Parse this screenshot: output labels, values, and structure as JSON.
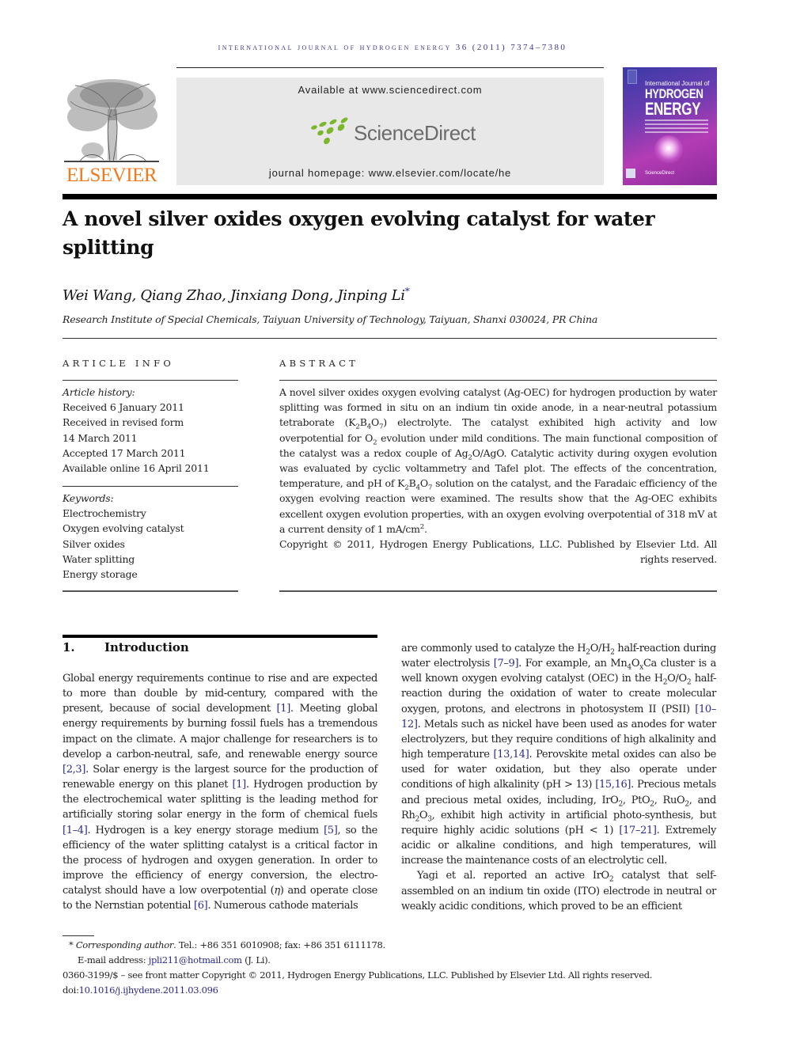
{
  "running_head": "INTERNATIONAL JOURNAL OF HYDROGEN ENERGY 36 (2011) 7374–7380",
  "header": {
    "publisher_logo": "ELSEVIER",
    "available_at": "Available at www.sciencedirect.com",
    "sciencedirect_logo": "ScienceDirect",
    "journal_homepage": "journal homepage: www.elsevier.com/locate/he",
    "cover": {
      "line1": "International Journal of",
      "line2": "HYDROGEN",
      "line3": "ENERGY",
      "footer": "ScienceDirect"
    },
    "colors": {
      "elsevier_orange": "#f07a1e",
      "sciencedirect_green": "#7bb72b",
      "running_head_blue": "#3a3a8c",
      "link_blue": "#2a2a8a"
    }
  },
  "article": {
    "title": "A novel silver oxides oxygen evolving catalyst for water splitting",
    "authors": "Wei Wang, Qiang Zhao, Jinxiang Dong, Jinping Li",
    "corresponding_mark": "*",
    "affiliation": "Research Institute of Special Chemicals, Taiyuan University of Technology, Taiyuan, Shanxi 030024, PR China"
  },
  "article_info": {
    "heading": "ARTICLE INFO",
    "history_label": "Article history:",
    "history": [
      "Received 6 January 2011",
      "Received in revised form",
      "14 March 2011",
      "Accepted 17 March 2011",
      "Available online 16 April 2011"
    ],
    "keywords_label": "Keywords:",
    "keywords": [
      "Electrochemistry",
      "Oxygen evolving catalyst",
      "Silver oxides",
      "Water splitting",
      "Energy storage"
    ]
  },
  "abstract": {
    "heading": "ABSTRACT",
    "p1": "A novel silver oxides oxygen evolving catalyst (Ag-OEC) for hydrogen production by water splitting was formed in situ on an indium tin oxide anode, in a near-neutral potassium tetraborate (",
    "p2": ") electrolyte. The catalyst exhibited high activity and low overpotential for ",
    "p3": " evolution under mild conditions. The main functional composition of the catalyst was a redox couple of ",
    "p4": ". Catalytic activity during oxygen evolution was evaluated by cyclic voltammetry and Tafel plot. The effects of the concentration, temperature, and pH of ",
    "p5": " solution on the catalyst, and the Faradaic efficiency of the oxygen evolving reaction were examined. The results show that the Ag-OEC exhibits excellent oxygen evolution properties, with an oxygen evolving overpotential of 318 mV at a current density of 1 mA/cm",
    "p6": ".",
    "copyright": "Copyright © 2011, Hydrogen Energy Publications, LLC. Published by Elsevier Ltd. All rights reserved."
  },
  "introduction": {
    "number": "1.",
    "heading": "Introduction"
  },
  "footnotes": {
    "corresponding": "Corresponding author",
    "contact": ". Tel.: +86 351 6010908; fax: +86 351 6111178.",
    "email_label": "E-mail address: ",
    "email": "jpli211@hotmail.com",
    "email_suffix": " (J. Li).",
    "issn_line": "0360-3199/$ – see front matter Copyright © 2011, Hydrogen Energy Publications, LLC. Published by Elsevier Ltd. All rights reserved.",
    "doi_label": "doi:",
    "doi": "10.1016/j.ijhydene.2011.03.096"
  }
}
